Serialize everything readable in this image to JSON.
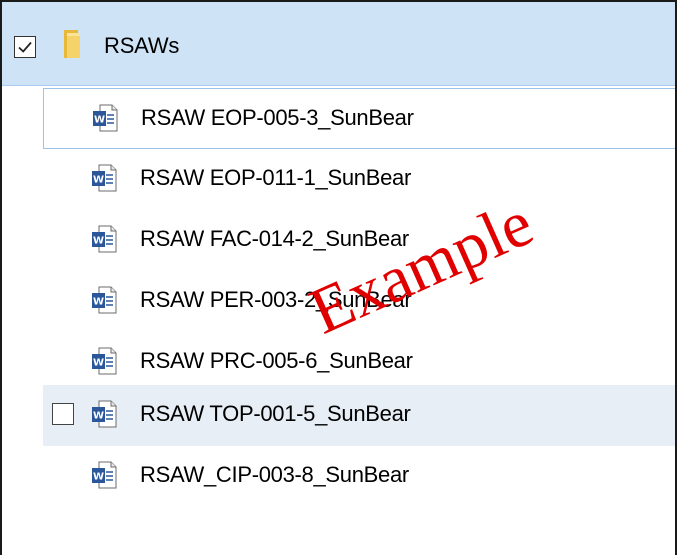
{
  "folder": {
    "name": "RSAWs",
    "checked": true,
    "icon": "folder-icon"
  },
  "files": [
    {
      "name": "RSAW EOP-005-3_SunBear",
      "icon": "word-document-icon",
      "state": "focused"
    },
    {
      "name": "RSAW EOP-011-1_SunBear",
      "icon": "word-document-icon",
      "state": "normal"
    },
    {
      "name": "RSAW FAC-014-2_SunBear",
      "icon": "word-document-icon",
      "state": "normal"
    },
    {
      "name": "RSAW PER-003-2_SunBear",
      "icon": "word-document-icon",
      "state": "normal"
    },
    {
      "name": "RSAW PRC-005-6_SunBear",
      "icon": "word-document-icon",
      "state": "normal"
    },
    {
      "name": "RSAW TOP-001-5_SunBear",
      "icon": "word-document-icon",
      "state": "hovered",
      "checkbox_visible": true,
      "checked": false
    },
    {
      "name": "RSAW_CIP-003-8_SunBear",
      "icon": "word-document-icon",
      "state": "normal"
    }
  ],
  "watermark": {
    "text": "Example",
    "color": "#e10000"
  },
  "colors": {
    "selection_bg": "#cfe3f7",
    "focus_border": "#9cc4ea",
    "hover_bg": "#e7eef6",
    "folder_yellow": "#f2c94c",
    "word_blue": "#2b579a"
  }
}
